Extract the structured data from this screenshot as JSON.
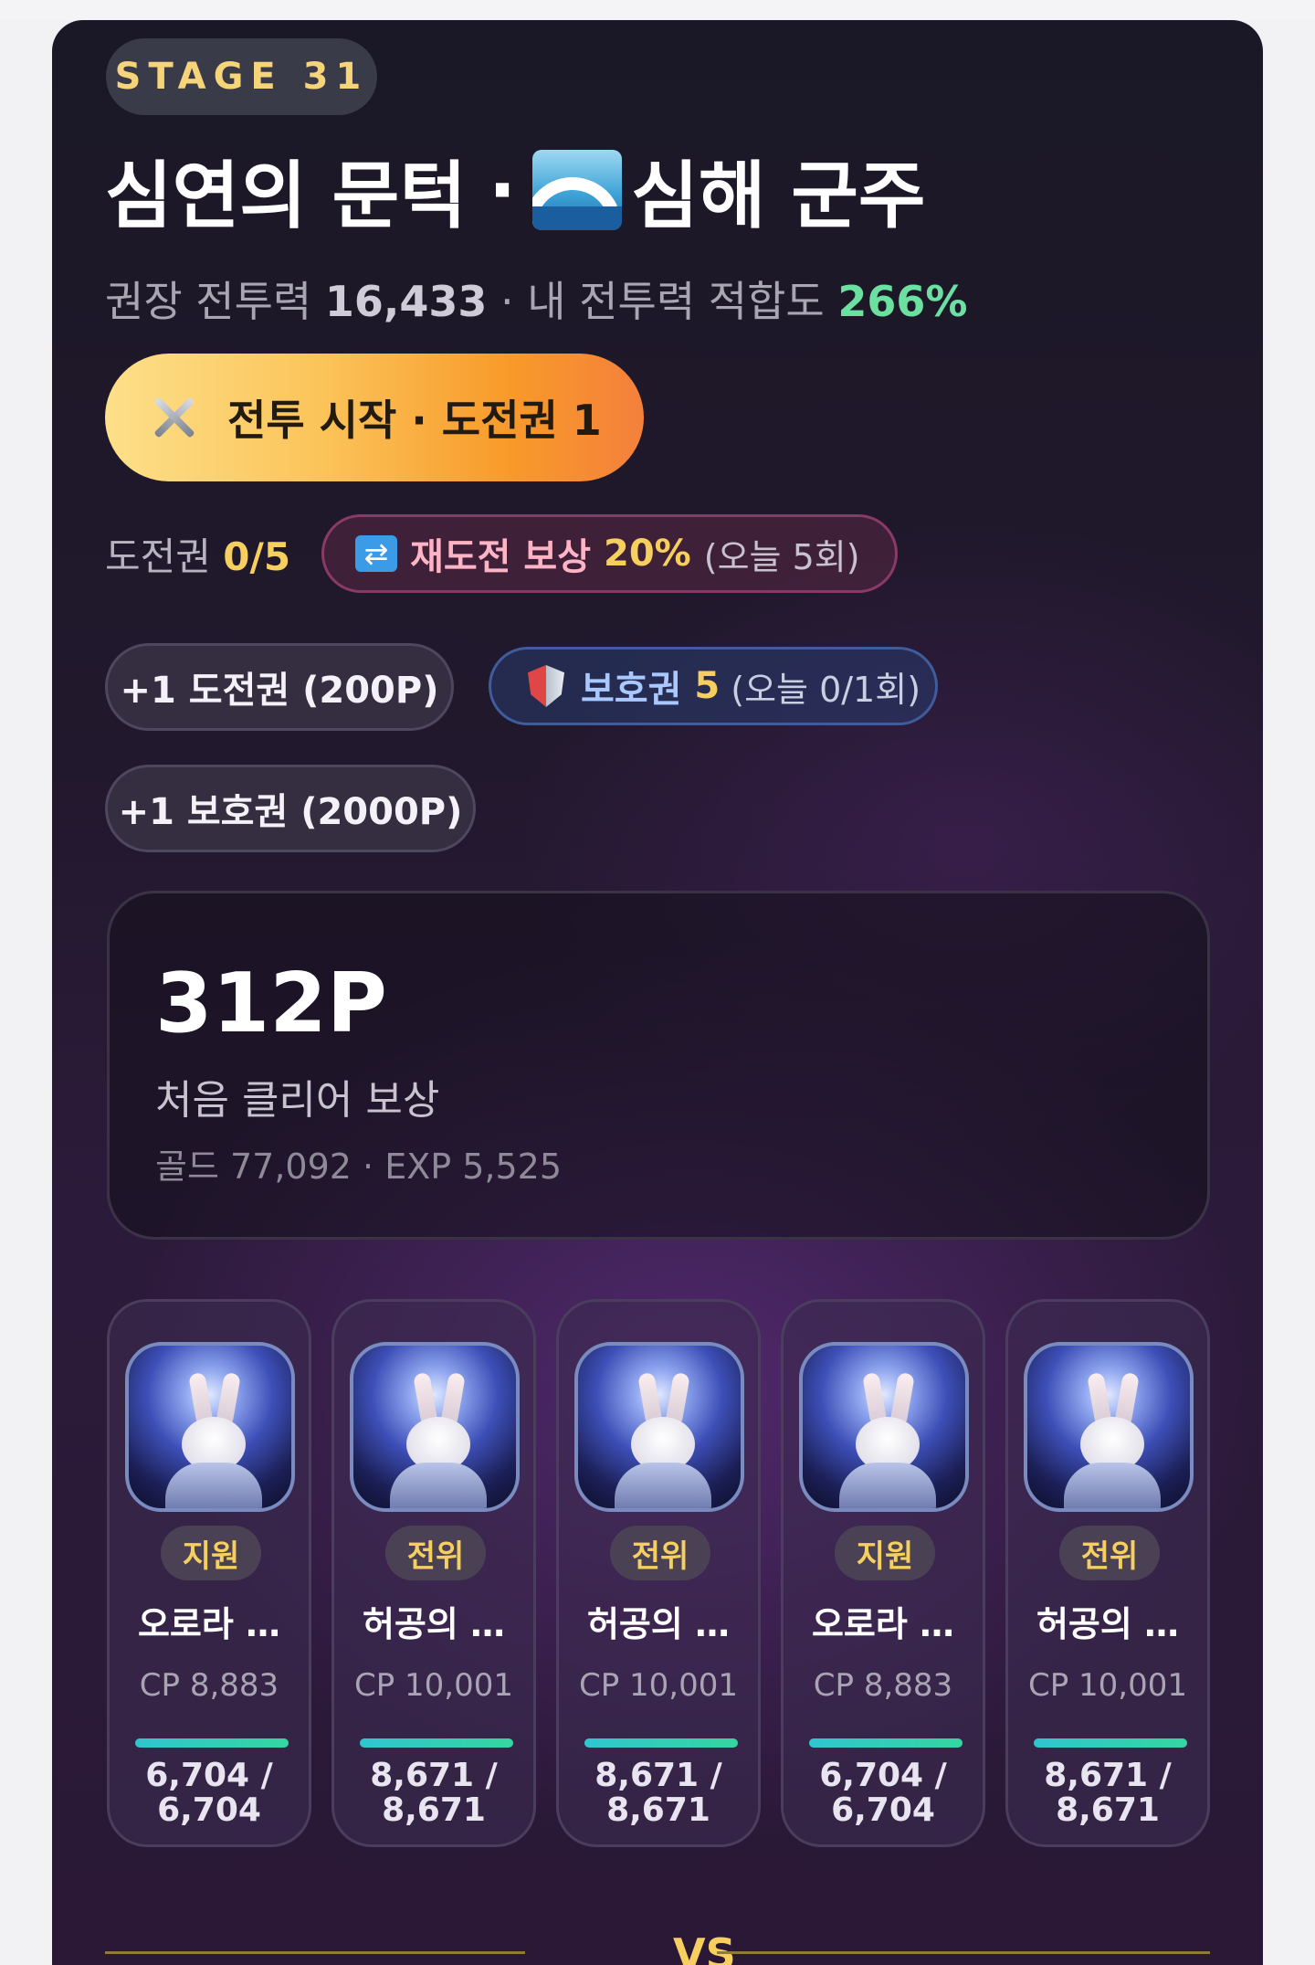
{
  "stage": {
    "label": "STAGE 31"
  },
  "title": {
    "name": "심연의 문턱",
    "separator": "·",
    "icon": "wave-icon",
    "boss": "심해 군주"
  },
  "power": {
    "recommended_label": "권장 전투력",
    "recommended_value": "16,433",
    "separator": "·",
    "fit_label": "내 전투력 적합도",
    "fit_value": "266%"
  },
  "start_button": {
    "label": "전투 시작 · 도전권 1",
    "icon": "crossed-swords-icon"
  },
  "tickets": {
    "label": "도전권",
    "value": "0/5",
    "retry_icon": "repeat-icon",
    "retry_label": "재도전 보상",
    "retry_value": "20%",
    "retry_note": "(오늘 5회)"
  },
  "shop": {
    "buy_ticket_label": "+1 도전권 (200P)",
    "shield_label": "보호권",
    "shield_value": "5",
    "shield_note": "(오늘 0/1회)",
    "buy_shield_label": "+1 보호권 (2000P)"
  },
  "reward": {
    "points": "312P",
    "label": "처음 클리어 보상",
    "sub": "골드 77,092 · EXP 5,525"
  },
  "team": [
    {
      "role": "지원",
      "name": "오로라 …",
      "cp": "CP 8,883",
      "hp_line1": "6,704 /",
      "hp_line2": "6,704",
      "hp_fraction": 1.0
    },
    {
      "role": "전위",
      "name": "허공의 …",
      "cp": "CP 10,001",
      "hp_line1": "8,671 /",
      "hp_line2": "8,671",
      "hp_fraction": 1.0
    },
    {
      "role": "전위",
      "name": "허공의 …",
      "cp": "CP 10,001",
      "hp_line1": "8,671 /",
      "hp_line2": "8,671",
      "hp_fraction": 1.0
    },
    {
      "role": "지원",
      "name": "오로라 …",
      "cp": "CP 8,883",
      "hp_line1": "6,704 /",
      "hp_line2": "6,704",
      "hp_fraction": 1.0
    },
    {
      "role": "전위",
      "name": "허공의 …",
      "cp": "CP 10,001",
      "hp_line1": "8,671 /",
      "hp_line2": "8,671",
      "hp_fraction": 1.0
    }
  ],
  "vs": {
    "label": "VS"
  },
  "colors": {
    "accent_gold": "#f6cf5e",
    "fit_green": "#6ce0a0",
    "hp_bar": "#34d6a0"
  }
}
